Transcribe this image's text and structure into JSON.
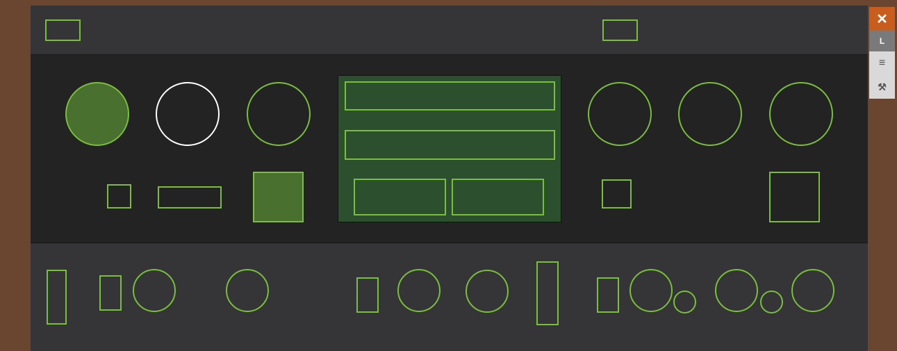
{
  "colors": {
    "rail": "#6a4631",
    "panel_dark": "#232323",
    "panel_strip": "#353538",
    "outline_accent": "#79bf3b",
    "active_fill": "#4a7030",
    "display_bg": "#2c4f2e",
    "close_button": "#c95d1e"
  },
  "side_toolbar": {
    "close_icon": "✕",
    "lock_label": "L",
    "menu_icon": "≡",
    "tools_icon": "⚒"
  }
}
